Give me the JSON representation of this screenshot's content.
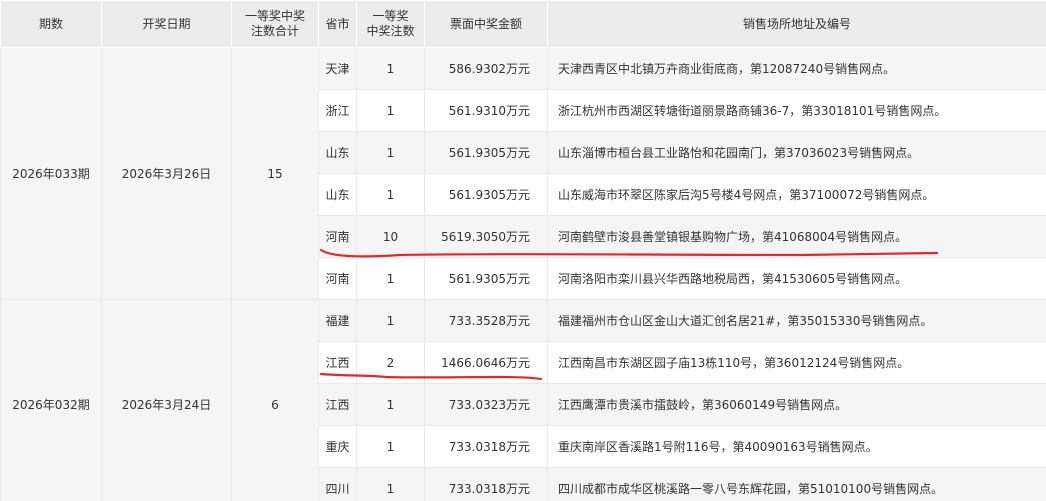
{
  "headers": {
    "period": "期数",
    "date": "开奖日期",
    "total_line1": "一等奖中奖",
    "total_line2": "注数合计",
    "province": "省市",
    "count_line1": "一等奖",
    "count_line2": "中奖注数",
    "amount": "票面中奖金额",
    "address": "销售场所地址及编号"
  },
  "groups": [
    {
      "period": "2026年033期",
      "date": "2026年3月26日",
      "total": "15",
      "rows": [
        {
          "province": "天津",
          "count": "1",
          "amount": "586.9302万元",
          "address": "天津西青区中北镇万卉商业街底商，第12087240号销售网点。"
        },
        {
          "province": "浙江",
          "count": "1",
          "amount": "561.9310万元",
          "address": "浙江杭州市西湖区转塘街道丽景路商铺36-7，第33018101号销售网点。"
        },
        {
          "province": "山东",
          "count": "1",
          "amount": "561.9305万元",
          "address": "山东淄博市桓台县工业路怡和花园南门，第37036023号销售网点。"
        },
        {
          "province": "山东",
          "count": "1",
          "amount": "561.9305万元",
          "address": "山东威海市环翠区陈家后沟5号楼4号网点，第37100072号销售网点。"
        },
        {
          "province": "河南",
          "count": "10",
          "amount": "5619.3050万元",
          "address": "河南鹤壁市浚县善堂镇银基购物广场，第41068004号销售网点。"
        },
        {
          "province": "河南",
          "count": "1",
          "amount": "561.9305万元",
          "address": "河南洛阳市栾川县兴华西路地税局西，第41530605号销售网点。"
        }
      ]
    },
    {
      "period": "2026年032期",
      "date": "2026年3月24日",
      "total": "6",
      "rows": [
        {
          "province": "福建",
          "count": "1",
          "amount": "733.3528万元",
          "address": "福建福州市仓山区金山大道汇创名居21#，第35015330号销售网点。"
        },
        {
          "province": "江西",
          "count": "2",
          "amount": "1466.0646万元",
          "address": "江西南昌市东湖区园子庙13栋110号，第36012124号销售网点。"
        },
        {
          "province": "江西",
          "count": "1",
          "amount": "733.0323万元",
          "address": "江西鹰潭市贵溪市擂鼓岭，第36060149号销售网点。"
        },
        {
          "province": "重庆",
          "count": "1",
          "amount": "733.0318万元",
          "address": "重庆南岸区香溪路1号附116号，第40090163号销售网点。"
        },
        {
          "province": "四川",
          "count": "1",
          "amount": "733.0318万元",
          "address": "四川成都市成华区桃溪路一零八号东辉花园，第51010100号销售网点。"
        }
      ]
    }
  ],
  "colors": {
    "header_bg": "#ececec",
    "stripe_bg": "#f5f5f5",
    "annotation_red": "#e0282e"
  }
}
